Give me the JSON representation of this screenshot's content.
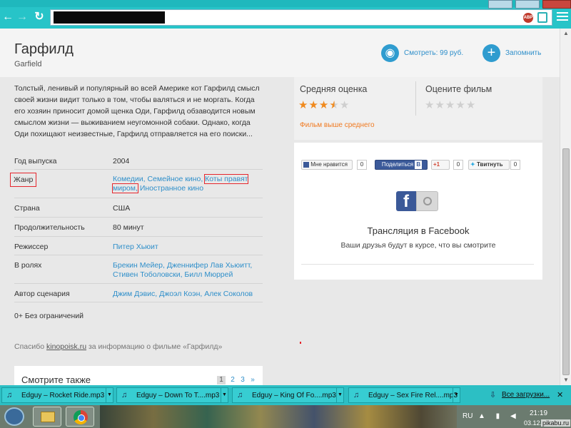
{
  "browser": {
    "url": "",
    "abp_label": "ABP"
  },
  "movie": {
    "title": "Гарфилд",
    "original_title": "Garfield",
    "watch_label": "Смотреть: 99 руб.",
    "save_label": "Запомнить",
    "description": "Толстый, ленивый и популярный во всей Америке кот Гарфилд смысл своей жизни видит только в том, чтобы валяться и не моргать. Когда его хозяин приносит домой щенка Оди, Гарфилд обзаводится новым смыслом жизни — выживанием неугомонной собаки. Однако, когда Оди похищают неизвестные, Гарфилд отправляется на его поиски...",
    "details": {
      "year_label": "Год выпуска",
      "year": "2004",
      "genre_label": "Жанр",
      "genre_1": "Комедии, Семейное кино,",
      "genre_2": "Коты правят",
      "genre_3": "миром,",
      "genre_4": "Иностранное кино",
      "country_label": "Страна",
      "country": "США",
      "duration_label": "Продолжительность",
      "duration": "80 минут",
      "director_label": "Режиссер",
      "director": "Питер Хьюит",
      "cast_label": "В ролях",
      "cast": "Брекин Мейер, Дженнифер Лав Хьюитт, Стивен Тоболовски, Билл Мюррей",
      "writer_label": "Автор сценария",
      "writer": "Джим Дэвис, Джоэл Коэн, Алек Соколов"
    },
    "age": "0+ Без ограничений",
    "thanks_prefix": "Спасибо",
    "thanks_link": "kinopoisk.ru",
    "thanks_suffix": "за информацию о фильме «Гарфилд»",
    "see_also": "Смотрите также",
    "pages": [
      "1",
      "2",
      "3",
      "»"
    ]
  },
  "rating": {
    "avg_label": "Средняя оценка",
    "rate_label": "Оцените фильм",
    "avg_stars": 3.5,
    "max_stars": 5,
    "avg_caption": "Фильм выше среднего"
  },
  "social": {
    "like_label": "Мне нравится",
    "like_count": "0",
    "share_label": "Поделиться",
    "share_badge": "В",
    "gplus_label": "+1",
    "gplus_count": "0",
    "tweet_label": "Твитнуть",
    "tweet_count": "0",
    "fb_logo": "f",
    "fb_title": "Трансляция в Facebook",
    "fb_subtitle": "Ваши друзья будут в курсе, что вы смотрите"
  },
  "downloads": {
    "items": [
      "Edguy – Rocket Ride.mp3",
      "Edguy – Down To T....mp3",
      "Edguy – King Of Fo....mp3",
      "Edguy – Sex Fire Rel....mp3"
    ],
    "all_label": "Все загрузки..."
  },
  "taskbar": {
    "lang": "RU",
    "time": "21:19",
    "date": "03.12.",
    "watermark": "pikabu.ru"
  },
  "colors": {
    "chrome": "#27c4c8",
    "link": "#2f8fca",
    "star": "#f08a1e",
    "highlight": "#e5262d"
  }
}
